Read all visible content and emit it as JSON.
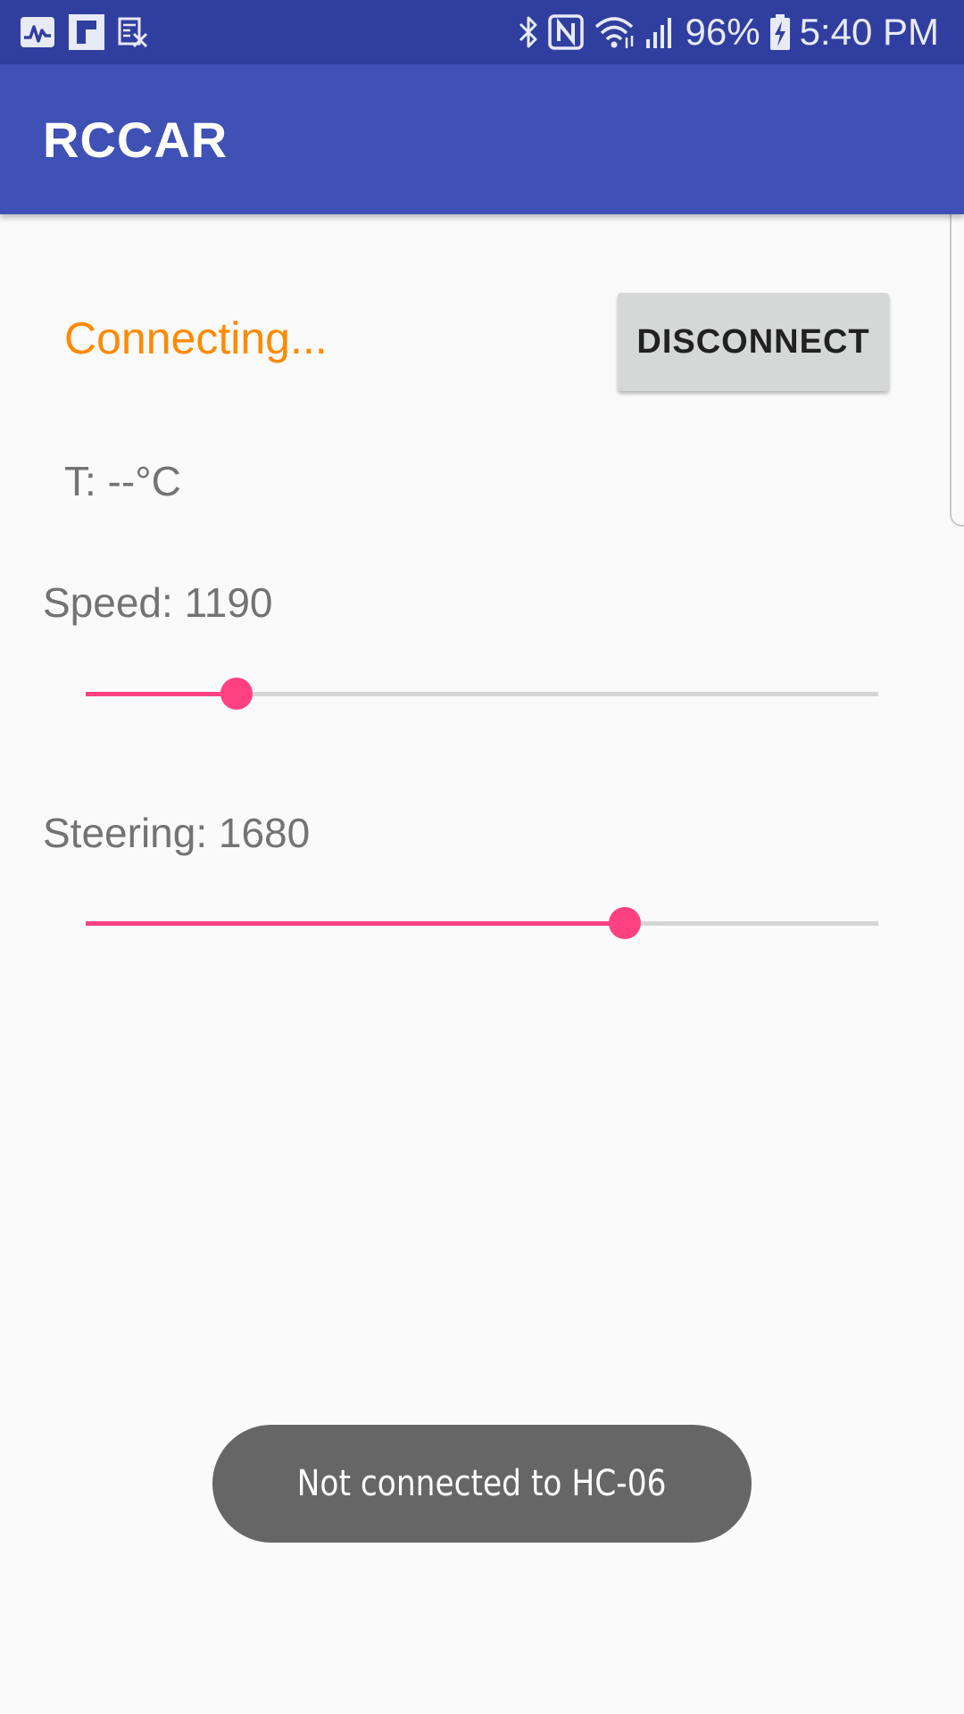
{
  "status_bar": {
    "battery": "96%",
    "time": "5:40 PM",
    "left_icons": [
      "activity-icon",
      "flipboard-icon",
      "calendar-x-icon"
    ],
    "right_icons": [
      "bluetooth-icon",
      "nfc-icon",
      "wifi-icon",
      "signal-icon",
      "battery-charging-icon"
    ]
  },
  "app_bar": {
    "title": "RCCAR",
    "color": "#3f51b5"
  },
  "connection": {
    "status": "Connecting...",
    "status_color": "#ff8a00",
    "button_label": "DISCONNECT"
  },
  "temperature": {
    "label": "T: --°C"
  },
  "speed": {
    "label": "Speed: 1190",
    "level": 0.19
  },
  "steering": {
    "label": "Steering: 1680",
    "level": 0.68
  },
  "toast": {
    "message": "Not connected to HC-06"
  },
  "accent_color": "#ff4081"
}
